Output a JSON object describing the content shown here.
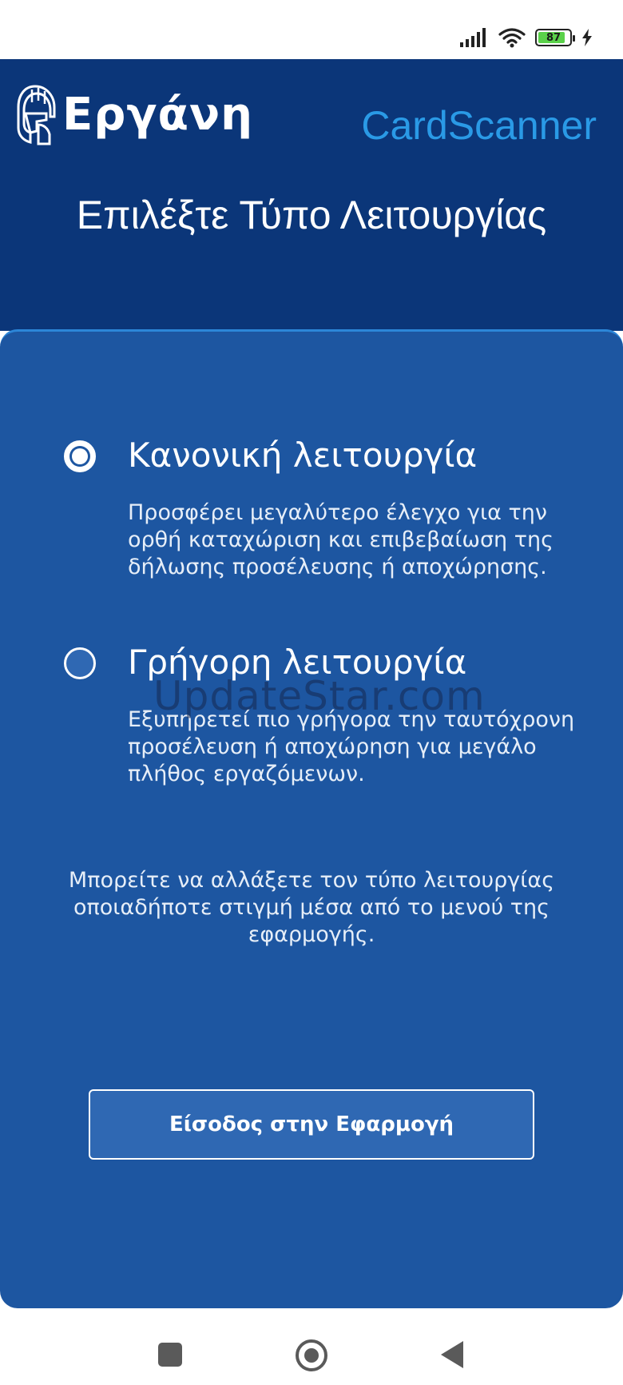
{
  "status_bar": {
    "battery_level": "87",
    "battery_fraction": 0.87,
    "icons": [
      "signal-icon",
      "wifi-icon",
      "battery-icon",
      "charging-icon"
    ]
  },
  "header": {
    "logo_text": "Εργάνη",
    "app_name": "CardScanner",
    "title": "Επιλέξτε Τύπο Λειτουργίας"
  },
  "options": [
    {
      "title": "Κανονική λειτουργία",
      "description": "Προσφέρει μεγαλύτερο έλεγχο για την ορθή καταχώριση και επιβεβαίωση της δήλωσης προσέλευσης ή αποχώρησης.",
      "selected": true
    },
    {
      "title": "Γρήγορη λειτουργία",
      "description": "Εξυπηρετεί πιο γρήγορα την ταυτόχρονη προσέλευση ή αποχώρηση για μεγάλο πλήθος εργαζόμενων.",
      "selected": false
    }
  ],
  "info_text": "Μπορείτε να αλλάξετε τον τύπο λειτουργίας οποιαδήποτε στιγμή μέσα από το μενού της εφαρμογής.",
  "enter_button_label": "Είσοδος στην Εφαρμογή",
  "watermark": "UpdateStar.com",
  "colors": {
    "header_bg": "#0b3679",
    "card_bg": "#1d56a1",
    "accent": "#2a9ae6"
  }
}
